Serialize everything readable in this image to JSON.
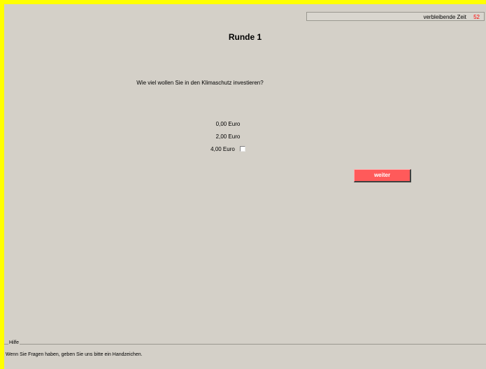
{
  "timer": {
    "label": "verbleibende Zeit",
    "value": "52",
    "value_color": "#ff0000"
  },
  "round": {
    "title": "Runde 1"
  },
  "question": {
    "text": "Wie viel wollen Sie in den Klimaschutz investieren?"
  },
  "options": [
    {
      "label": "0,00 Euro",
      "has_checkbox": false
    },
    {
      "label": "2,00 Euro",
      "has_checkbox": false
    },
    {
      "label": "4,00 Euro",
      "has_checkbox": true,
      "checked": false
    }
  ],
  "buttons": {
    "next_label": "weiter",
    "next_color": "#ff5a5a"
  },
  "help": {
    "legend": "Hilfe",
    "text": "Wenn Sie Fragen haben, geben Sie uns bitte ein Handzeichen."
  },
  "colors": {
    "frame_border": "#ffff00",
    "background": "#d4d0c8"
  }
}
